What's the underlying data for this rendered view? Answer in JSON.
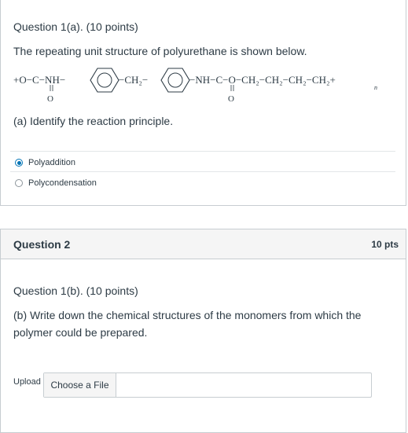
{
  "question1": {
    "title": "Question 1(a). (10 points)",
    "prompt": "The repeating unit structure of polyurethane is shown below.",
    "structure": {
      "bracket_left": "+O−C−NH−",
      "ch2_middle": "−CH₂−",
      "right_chain": "−NH−C−O−CH₂−CH₂−CH₂−CH₂+",
      "carbonyl_o": "O",
      "subscript_n": "n"
    },
    "sub_question": "(a) Identify the reaction principle.",
    "options": [
      {
        "label": "Polyaddition",
        "selected": true
      },
      {
        "label": "Polycondensation",
        "selected": false
      }
    ]
  },
  "question2": {
    "name": "Question 2",
    "points": "10 pts",
    "title": "Question 1(b). (10 points)",
    "text": "(b) Write down the chemical structures of the monomers from which the polymer could be prepared.",
    "upload_label": "Upload",
    "choose_file_label": "Choose a File"
  },
  "colors": {
    "accent": "#0374b5",
    "text": "#2d3b45",
    "border": "#c7cdd1",
    "header_bg": "#f5f5f5"
  }
}
